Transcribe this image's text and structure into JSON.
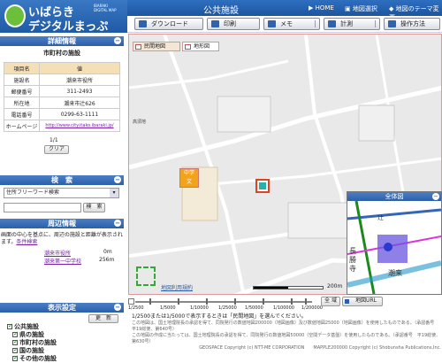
{
  "header": {
    "logo_line1": "いばらき",
    "logo_sub": "IBARAKI\nDIGITAL MAP",
    "logo_line2": "デジタルまっぷ",
    "title": "公共施設",
    "links": [
      "HOME",
      "地図選択",
      "地図のテーマ変更"
    ]
  },
  "toolbar": {
    "download": "ダウンロード",
    "print": "印刷",
    "memo": "メモ",
    "measure": "計測",
    "help": "操作方法"
  },
  "detail": {
    "heading": "詳細情報",
    "subtitle": "市町村の施設",
    "rows": [
      {
        "k": "項目名",
        "v": "値"
      },
      {
        "k": "施設名",
        "v": "潮来市役所"
      },
      {
        "k": "郵便番号",
        "v": "311-2493"
      },
      {
        "k": "所在地",
        "v": "潮来市辻626"
      },
      {
        "k": "電話番号",
        "v": "0299-63-1111"
      },
      {
        "k": "ホームページ",
        "v": "http://www.city.itako.ibaraki.jp/"
      }
    ],
    "page": "1/1",
    "clear": "クリア"
  },
  "search": {
    "heading": "検　索",
    "select_value": "住所フリーワード検索",
    "button": "検　索"
  },
  "nearby": {
    "heading": "周辺情報",
    "text": "画面の中心を基点に、周辺の施設と距離が表示されます。",
    "link": "条件検索",
    "items": [
      {
        "name": "潮来市役所",
        "dist": "0m"
      },
      {
        "name": "潮来第一中学校",
        "dist": "256m"
      }
    ]
  },
  "display": {
    "heading": "表示設定",
    "update": "更　新",
    "layers": [
      "公共施設",
      "県の施設",
      "市町村の施設",
      "国の施設",
      "その他の施設"
    ]
  },
  "map": {
    "tab_private": "民間地図",
    "tab_terrain": "地形図",
    "label_school": "潮来第一中学校",
    "label_area": "高須地",
    "copyright_link": "地図利用規約",
    "scale": "200m",
    "overview_title": "全体図",
    "ov_label1": "辻",
    "ov_label2": "長勝寺",
    "ov_label3": "潮来"
  },
  "scale": {
    "ticks": [
      "1/2500",
      "1/5000",
      "1/10000",
      "1/25000",
      "1/50000",
      "1/100000",
      "1/200000"
    ],
    "hint": "1/2500または1/5000で表示するときは「民間地図」を選んでください。",
    "btn_full": "全 域",
    "btn_url": "地図URL"
  },
  "credits": {
    "line1": "この地図は、国土地理院長の承認を得て、同院発行の数値地図200000（地図画像）及び数値地図25000（地図画像）を使用したものである。（承認番号　平19総使、第640号）",
    "line2": "この地図の作成に当たっては、国土地理院長の承認を得て、同院発行の数値地図50000（空間データ基盤）を使用したものである。（承認番号　平19総使、第630号）",
    "line3": "GEOSPACE Copyright (c) NTT-ME CORPORATION　　MAPPLE200000 Copyright (c) Shobunsha Publications,Inc."
  },
  "colors": {
    "header_blue": "#1f5aa5",
    "accent_green": "#6bbf3a",
    "link_purple": "#7a1fa8"
  }
}
